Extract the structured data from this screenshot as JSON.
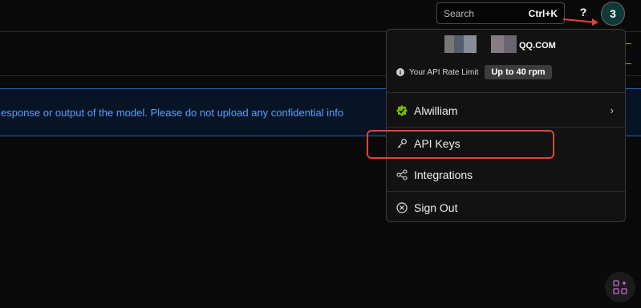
{
  "topbar": {
    "search_placeholder": "Search",
    "search_shortcut": "Ctrl+K",
    "help_label": "?",
    "avatar_label": "3"
  },
  "notice": {
    "text": "esponse or output of the model. Please do not upload any confidential info"
  },
  "account_menu": {
    "email_suffix": "QQ.COM",
    "rate_limit_label": "Your API Rate Limit",
    "rate_limit_value": "Up to 40 rpm",
    "items": [
      {
        "label": "Alwilliam",
        "icon": "verified-badge-icon"
      },
      {
        "label": "API Keys",
        "icon": "key-icon"
      },
      {
        "label": "Integrations",
        "icon": "share-nodes-icon"
      },
      {
        "label": "Sign Out",
        "icon": "close-circle-icon"
      }
    ]
  },
  "colors": {
    "background": "#0a0a0a",
    "accent_green": "#76b900",
    "notice_blue": "#5aa1ff",
    "annotation_red": "#e0433a",
    "avatar_bg": "#0f3a37"
  }
}
